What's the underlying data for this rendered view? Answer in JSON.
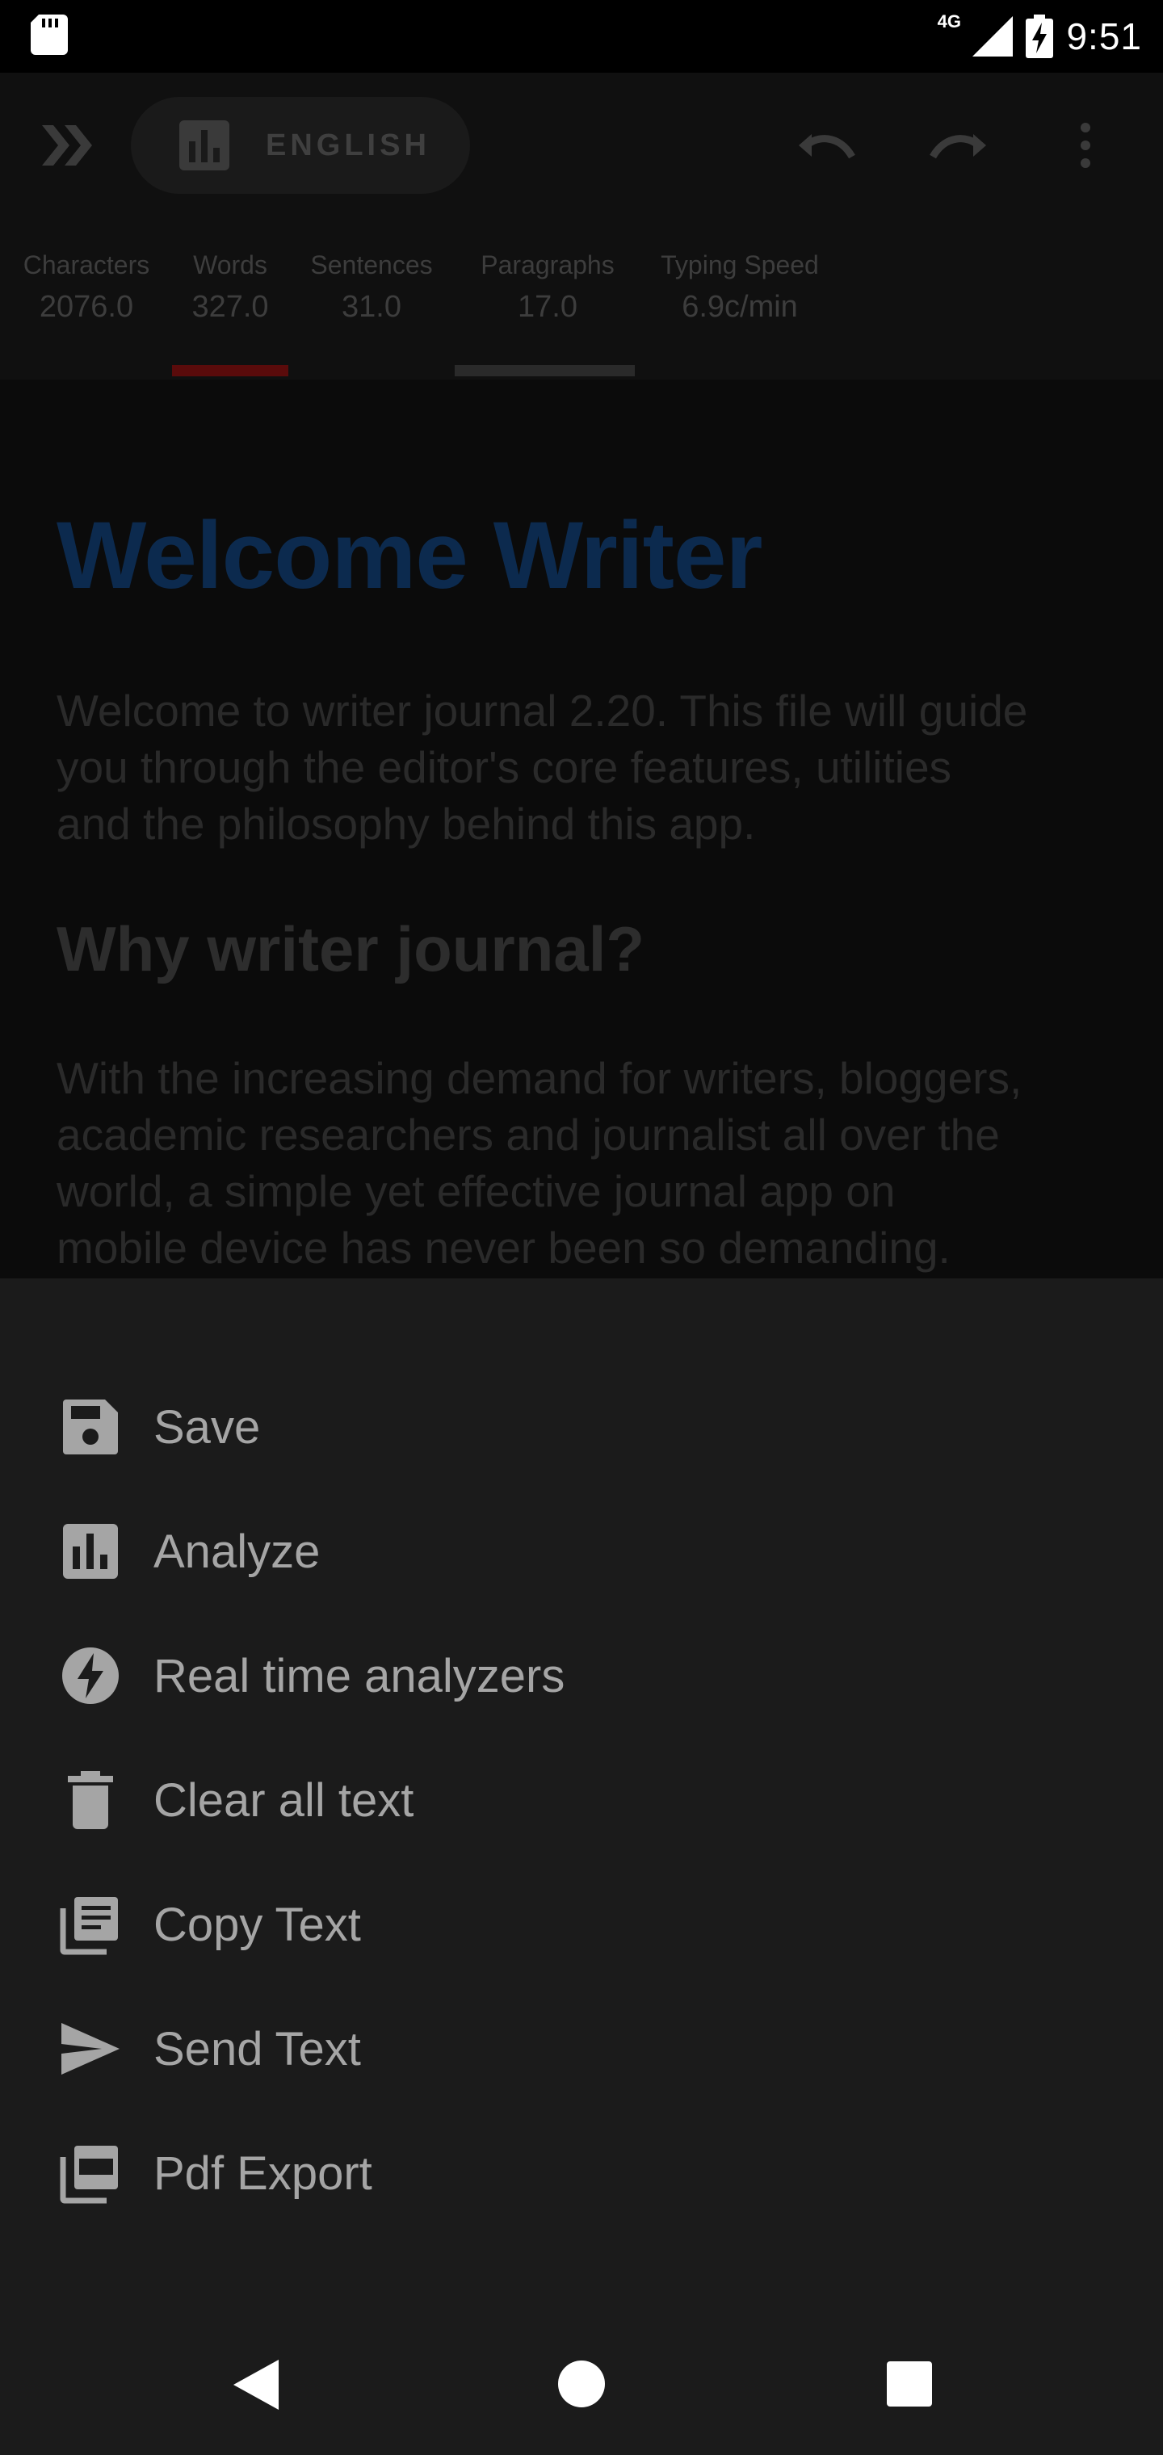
{
  "status_bar": {
    "network": "4G",
    "time": "9:51"
  },
  "app_bar": {
    "language": "ENGLISH"
  },
  "stats": [
    {
      "label": "Characters",
      "value": "2076.0"
    },
    {
      "label": "Words",
      "value": "327.0"
    },
    {
      "label": "Sentences",
      "value": "31.0"
    },
    {
      "label": "Paragraphs",
      "value": "17.0"
    },
    {
      "label": "Typing Speed",
      "value": "6.9c/min"
    }
  ],
  "document": {
    "title": "Welcome Writer",
    "intro_lines": [
      "Welcome to writer journal 2.20. This file will guide",
      "you through the editor's core features, utilities",
      "and the philosophy behind this app."
    ],
    "heading": "Why writer journal?",
    "body_lines": [
      "With the increasing demand for writers, bloggers,",
      "academic researchers and journalist all over the",
      "world, a simple yet effective journal app on",
      "mobile device has never been so demanding."
    ]
  },
  "menu": {
    "items": [
      {
        "label": "Save",
        "icon": "save-icon"
      },
      {
        "label": "Analyze",
        "icon": "analyze-icon"
      },
      {
        "label": "Real time analyzers",
        "icon": "bolt-icon"
      },
      {
        "label": "Clear all text",
        "icon": "trash-icon"
      },
      {
        "label": "Copy Text",
        "icon": "copy-text-icon"
      },
      {
        "label": "Send Text",
        "icon": "send-icon"
      },
      {
        "label": "Pdf Export",
        "icon": "pdf-icon"
      }
    ]
  },
  "colors": {
    "title_blue": "#0c2a4e",
    "active_tab_red": "#5a0b0b",
    "sheet_bg": "#1b1b1b"
  }
}
